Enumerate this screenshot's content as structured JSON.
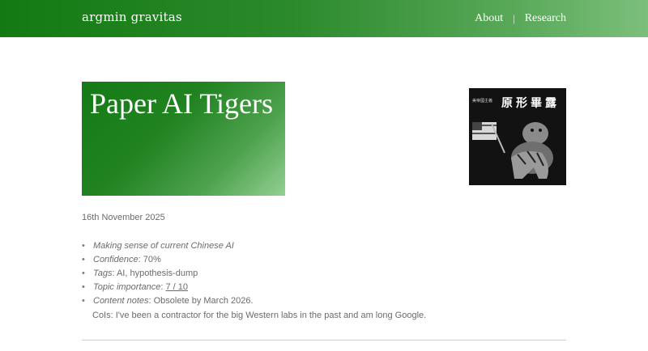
{
  "header": {
    "site_title": "argmin gravitas",
    "nav": [
      {
        "label": "About"
      },
      {
        "label": "Research"
      }
    ],
    "separator": "|"
  },
  "post": {
    "title": "Paper AI Tigers",
    "date": "16th November 2025",
    "meta": {
      "summary": "Making sense of current Chinese AI",
      "confidence_label": "Confidence",
      "confidence_value": ": 70%",
      "tags_label": "Tags",
      "tags_value": ": AI, hypothesis-dump",
      "topic_label": "Topic importance",
      "topic_sep": ": ",
      "topic_value": "7 / 10",
      "content_notes_label": "Content notes",
      "content_notes_value": ": Obsolete by March 2026.",
      "cois_line": "CoIs: I've been a contractor for the big Western labs in the past and am long Google."
    },
    "image": {
      "caption_cjk": "原形畢露",
      "caption_small": "美帝國主義"
    }
  },
  "colors": {
    "brand_green": "#137a13",
    "text_gray": "#6b6b6b"
  }
}
